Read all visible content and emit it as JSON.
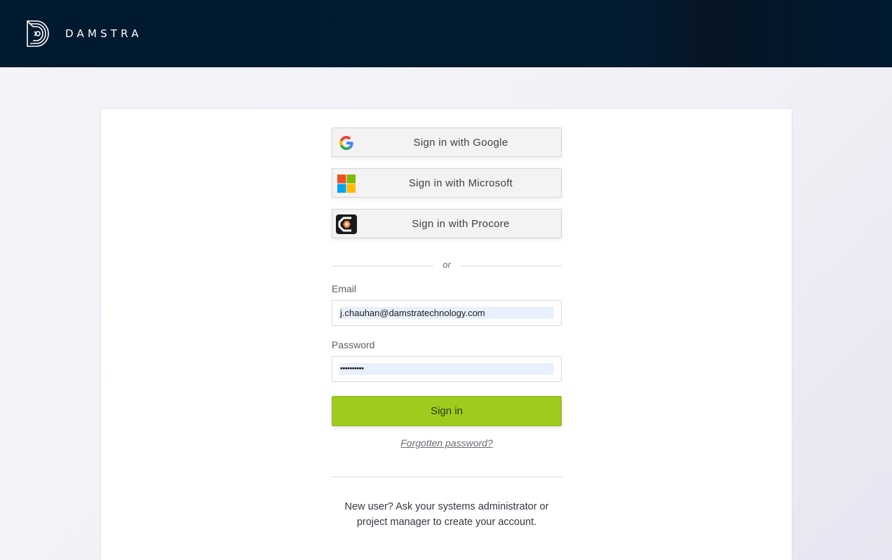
{
  "header": {
    "brand": "DAMSTRA",
    "logo_icon": "damstra-logo-icon"
  },
  "sso": {
    "google_label": "Sign in with Google",
    "microsoft_label": "Sign in with Microsoft",
    "procore_label": "Sign in with Procore"
  },
  "separator": {
    "or_text": "or"
  },
  "form": {
    "email_label": "Email",
    "email_value": "j.chauhan@damstratechnology.com",
    "password_label": "Password",
    "password_value": "••••••••••",
    "signin_label": "Sign in",
    "forgot_label": "Forgotten password?"
  },
  "footer": {
    "line1": "New user? Ask your systems administrator or",
    "line2": "project manager to create your account."
  },
  "colors": {
    "header_bg": "#021a30",
    "signin_green": "#9dcc1f"
  }
}
